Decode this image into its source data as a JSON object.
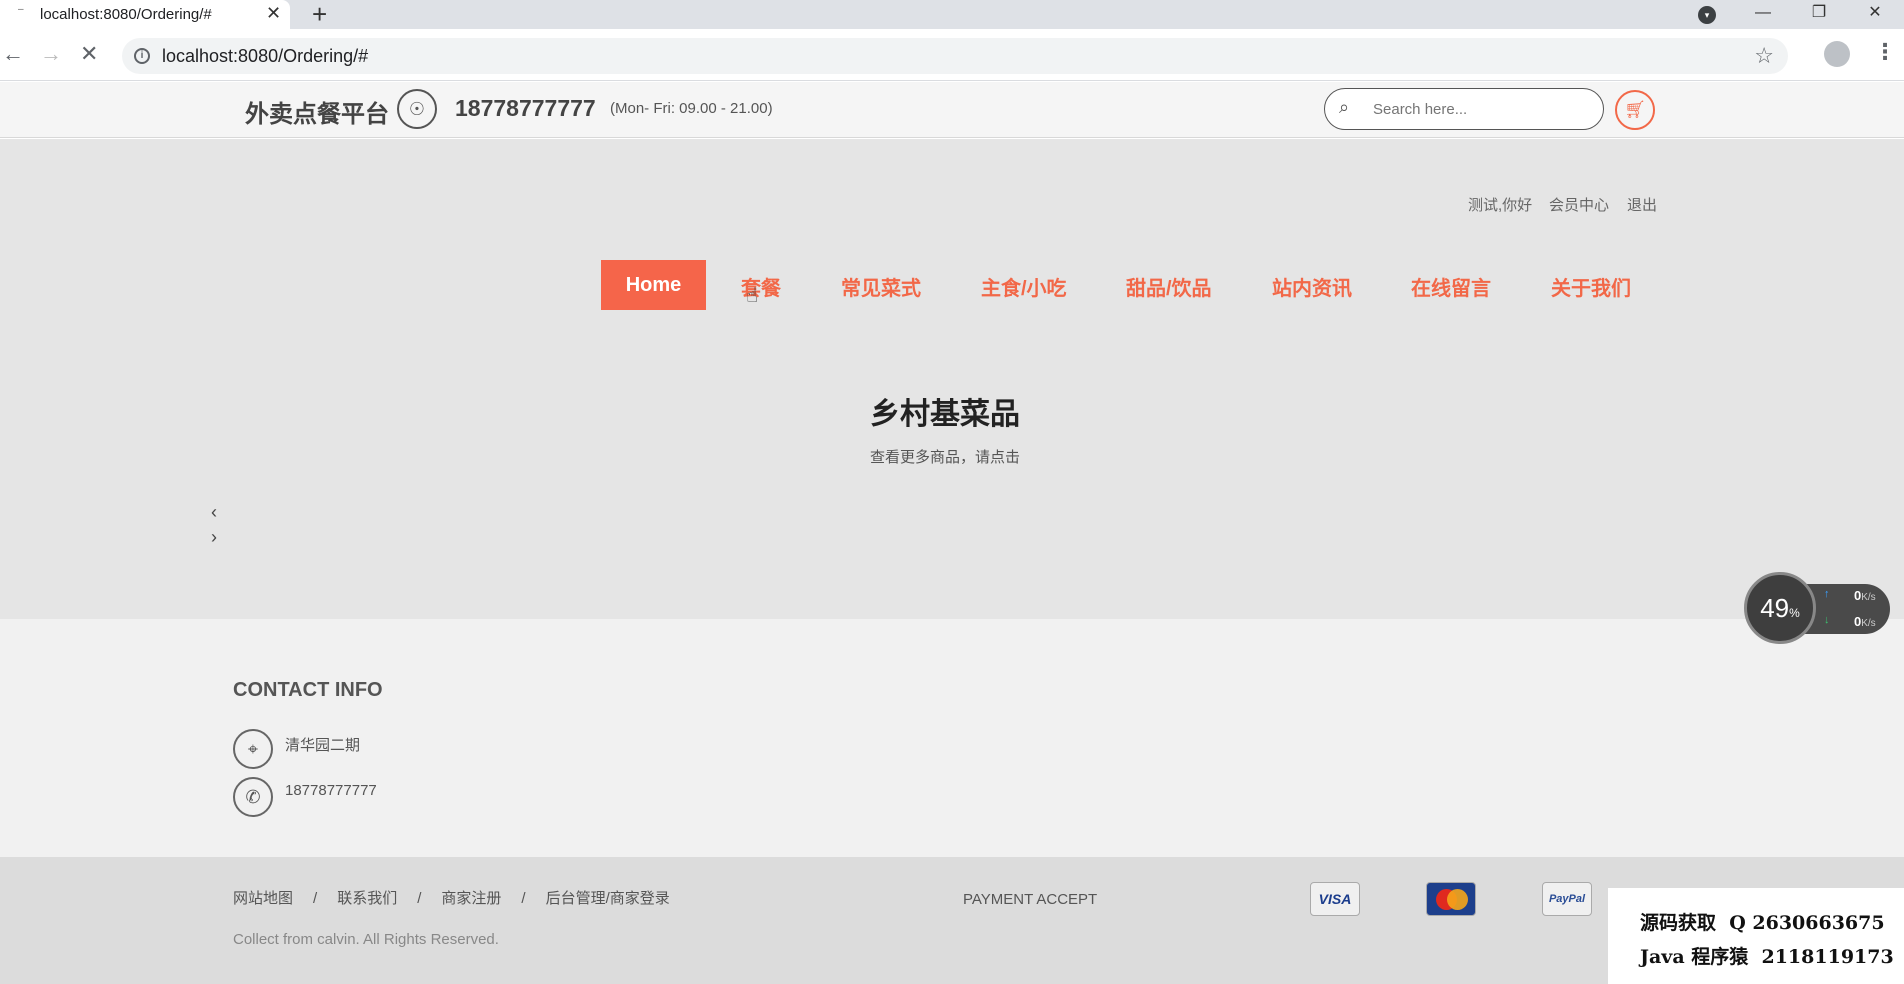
{
  "browser": {
    "tab_title": "localhost:8080/Ordering/#",
    "url": "localhost:8080/Ordering/#"
  },
  "header": {
    "brand": "外卖点餐平台",
    "phone": "18778777777",
    "hours": "(Mon- Fri: 09.00 - 21.00)",
    "search_placeholder": "Search here..."
  },
  "user_links": {
    "greeting": "测试,你好",
    "member_center": "会员中心",
    "logout": "退出"
  },
  "menu": {
    "home": "Home",
    "items": [
      "套餐",
      "常见菜式",
      "主食/小吃",
      "甜品/饮品",
      "站内资讯",
      "在线留言",
      "关于我们"
    ]
  },
  "hero": {
    "title": "乡村基菜品",
    "subtitle": "查看更多商品，请点击"
  },
  "contact": {
    "title": "CONTACT INFO",
    "address": "清华园二期",
    "phone": "18778777777"
  },
  "footer": {
    "links": [
      "网站地图",
      "联系我们",
      "商家注册",
      "后台管理/商家登录"
    ],
    "separator": "/",
    "copyright": "Collect from calvin. All Rights Reserved.",
    "payment_label": "PAYMENT ACCEPT",
    "cards": {
      "visa": "VISA",
      "paypal": "PayPal"
    }
  },
  "net_widget": {
    "percent": "49",
    "percent_unit": "%",
    "upload": "0",
    "download": "0",
    "unit": "K/s"
  },
  "watermark": {
    "line1": "源码获取  Q 2630663675",
    "line2": "Java 程序猿  2118119173"
  },
  "colors": {
    "accent": "#f26848",
    "hero_bg": "#e5e5e5",
    "footer_bg": "#dcdcdc"
  }
}
